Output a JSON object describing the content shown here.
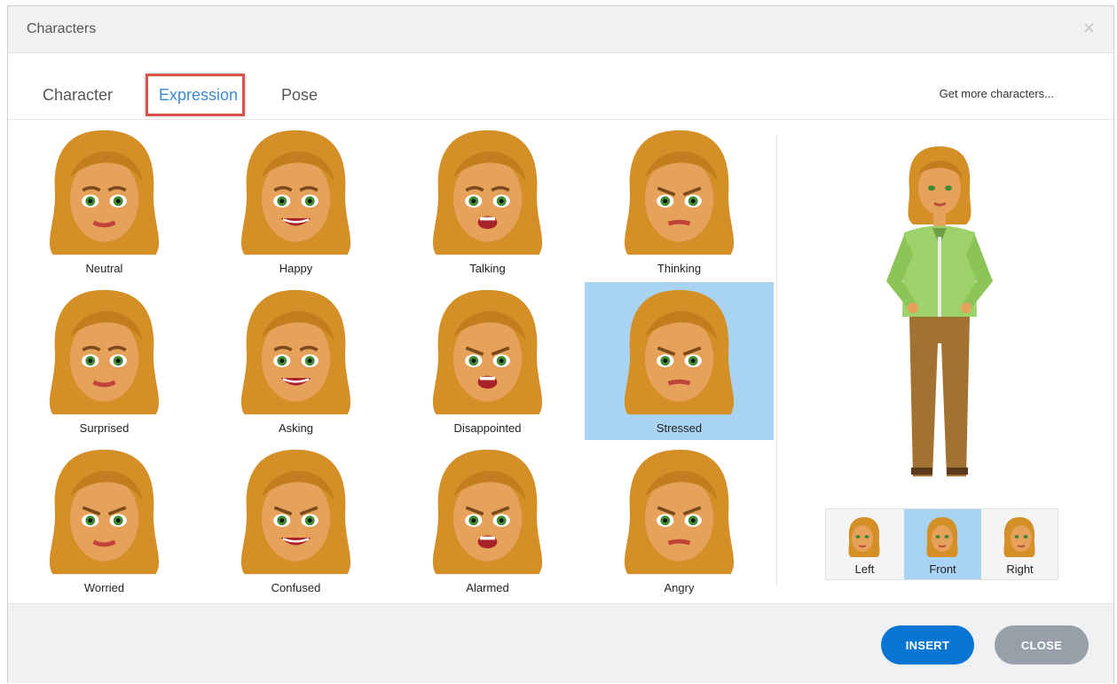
{
  "dialog": {
    "title": "Characters",
    "close_glyph": "×"
  },
  "tabs": [
    {
      "label": "Character",
      "active": false
    },
    {
      "label": "Expression",
      "active": true
    },
    {
      "label": "Pose",
      "active": false
    }
  ],
  "more_link": "Get more characters...",
  "expressions": [
    {
      "label": "Neutral",
      "selected": false
    },
    {
      "label": "Happy",
      "selected": false
    },
    {
      "label": "Talking",
      "selected": false
    },
    {
      "label": "Thinking",
      "selected": false
    },
    {
      "label": "Surprised",
      "selected": false
    },
    {
      "label": "Asking",
      "selected": false
    },
    {
      "label": "Disappointed",
      "selected": false
    },
    {
      "label": "Stressed",
      "selected": true
    },
    {
      "label": "Worried",
      "selected": false
    },
    {
      "label": "Confused",
      "selected": false
    },
    {
      "label": "Alarmed",
      "selected": false
    },
    {
      "label": "Angry",
      "selected": false
    }
  ],
  "views": [
    {
      "label": "Left",
      "active": false
    },
    {
      "label": "Front",
      "active": true
    },
    {
      "label": "Right",
      "active": false
    }
  ],
  "footer": {
    "insert_label": "INSERT",
    "close_label": "CLOSE"
  },
  "colors": {
    "accent": "#0a76d3",
    "selection": "#a9d3f3",
    "tab_highlight": "#d9534f"
  }
}
